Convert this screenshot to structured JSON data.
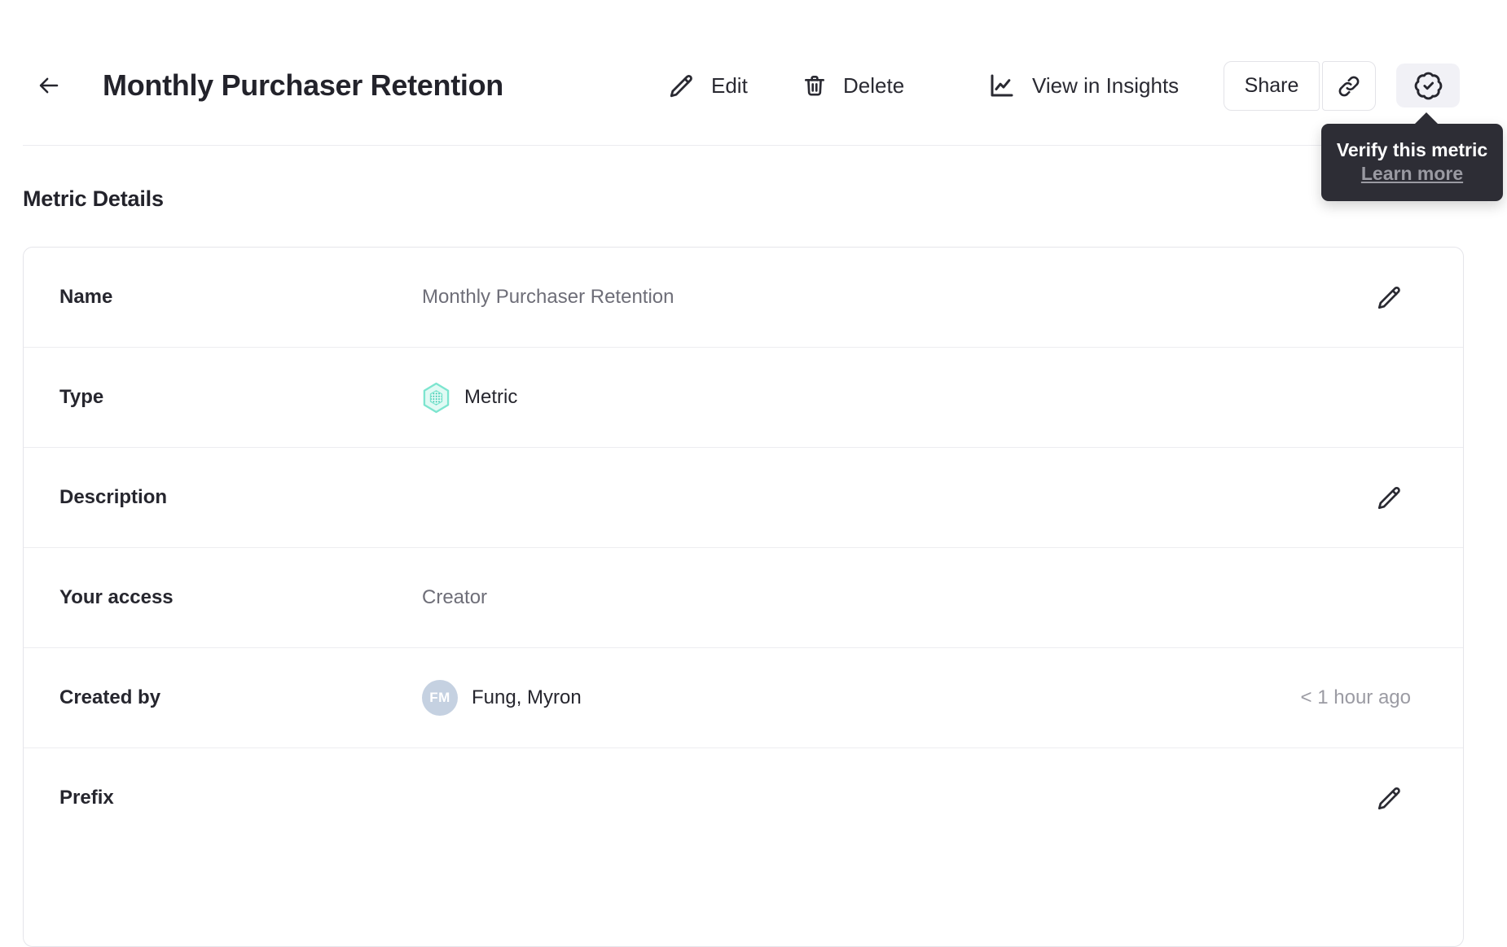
{
  "header": {
    "title": "Monthly Purchaser Retention",
    "actions": {
      "edit": "Edit",
      "delete": "Delete",
      "view_in_insights": "View in Insights",
      "share": "Share"
    },
    "icons": {
      "back": "arrow-left-icon",
      "edit": "pencil-icon",
      "delete": "trash-icon",
      "view_in_insights": "line-chart-icon",
      "copy_link": "link-icon",
      "verify": "seal-check-icon"
    }
  },
  "verify_tooltip": {
    "title": "Verify this metric",
    "link_label": "Learn more"
  },
  "metric_details": {
    "heading": "Metric Details",
    "rows": [
      {
        "label": "Name",
        "value": "Monthly Purchaser Retention"
      },
      {
        "label": "Type",
        "value": "Metric",
        "icon": "metric-hexagon-icon"
      },
      {
        "label": "Description",
        "value": ""
      },
      {
        "label": "Your access",
        "value": "Creator"
      },
      {
        "label": "Created by",
        "value": "Fung, Myron",
        "avatar_initials": "FM",
        "timestamp": "< 1 hour ago"
      },
      {
        "label": "Prefix",
        "value": ""
      }
    ]
  },
  "colors": {
    "accent_teal_border": "#7de5cf",
    "accent_teal_fill": "#e1faf4",
    "accent_teal_dots": "#2fc4ab",
    "avatar_bg": "#c5d1e1",
    "tooltip_bg": "#2d2d35",
    "text_dark": "#26262e",
    "text_gray": "#6e6e78",
    "text_light_gray": "#9b9ba3",
    "divider": "#ececf0",
    "card_border": "#e5e5ea",
    "verify_button_bg": "#f1f1f6"
  }
}
